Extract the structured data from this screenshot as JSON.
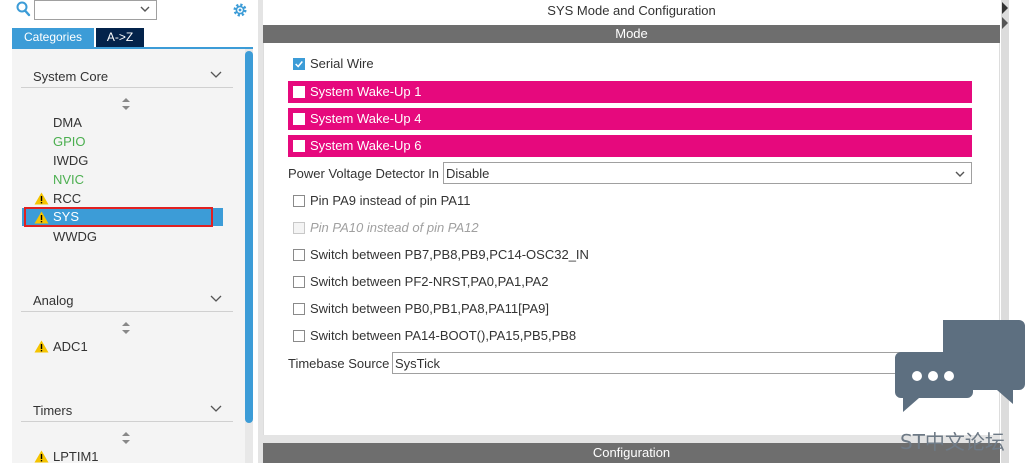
{
  "left": {
    "search": {
      "value": ""
    },
    "tabs": [
      {
        "label": "Categories"
      },
      {
        "label": "A->Z"
      }
    ],
    "categories": [
      {
        "label": "System Core"
      },
      {
        "label": "Analog"
      },
      {
        "label": "Timers"
      }
    ],
    "system_core_items": [
      {
        "label": "DMA",
        "state": "normal"
      },
      {
        "label": "GPIO",
        "state": "green"
      },
      {
        "label": "IWDG",
        "state": "normal"
      },
      {
        "label": "NVIC",
        "state": "green"
      },
      {
        "label": "RCC",
        "state": "warning"
      },
      {
        "label": "SYS",
        "state": "warning-selected"
      },
      {
        "label": "WWDG",
        "state": "normal"
      }
    ],
    "analog_items": [
      {
        "label": "ADC1",
        "state": "warning"
      }
    ],
    "timers_items": [
      {
        "label": "LPTIM1",
        "state": "warning"
      }
    ]
  },
  "right": {
    "title": "SYS Mode and Configuration",
    "mode_header": "Mode",
    "config_header": "Configuration",
    "serial_wire": {
      "label": "Serial Wire",
      "checked": true
    },
    "wakeups": [
      {
        "label": "System Wake-Up 1"
      },
      {
        "label": "System Wake-Up 4"
      },
      {
        "label": "System Wake-Up 6"
      }
    ],
    "pvd": {
      "label": "Power Voltage Detector In",
      "value": "Disable"
    },
    "options": [
      {
        "label": "Pin PA9 instead of pin PA11",
        "disabled": false
      },
      {
        "label": "Pin PA10 instead of pin PA12",
        "disabled": true
      },
      {
        "label": "Switch between PB7,PB8,PB9,PC14-OSC32_IN",
        "disabled": false
      },
      {
        "label": "Switch between PF2-NRST,PA0,PA1,PA2",
        "disabled": false
      },
      {
        "label": "Switch between PB0,PB1,PA8,PA11[PA9]",
        "disabled": false
      },
      {
        "label": "Switch between PA14-BOOT(),PA15,PB5,PB8",
        "disabled": false
      }
    ],
    "timebase": {
      "label": "Timebase Source",
      "value": "SysTick"
    }
  },
  "watermark": {
    "text": "ST中文论坛"
  },
  "colors": {
    "accent": "#3c9cd7",
    "pink": "#e6097d",
    "dark_tab": "#03234b",
    "warning": "#f5c400",
    "green": "#4caf50",
    "highlight_outline": "#e02020"
  }
}
